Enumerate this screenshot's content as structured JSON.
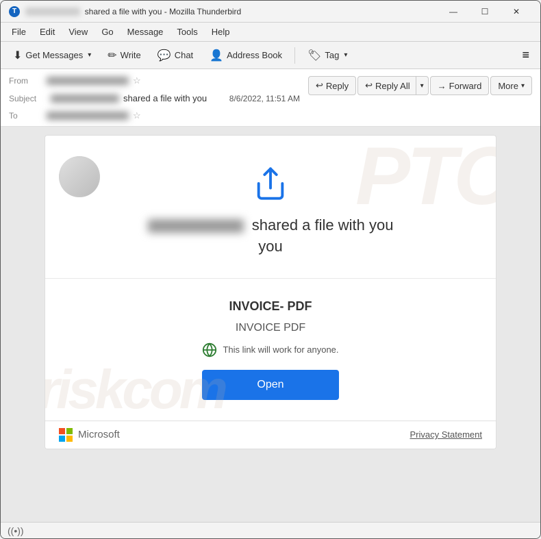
{
  "window": {
    "title_prefix": "shared a file with you - Mozilla Thunderbird",
    "icon": "T"
  },
  "titlebar": {
    "minimize": "—",
    "maximize": "☐",
    "close": "✕"
  },
  "menubar": {
    "items": [
      "File",
      "Edit",
      "View",
      "Go",
      "Message",
      "Tools",
      "Help"
    ]
  },
  "toolbar": {
    "get_messages": "Get Messages",
    "write": "Write",
    "chat": "Chat",
    "address_book": "Address Book",
    "tag": "Tag",
    "hamburger": "≡"
  },
  "email_header": {
    "from_label": "From",
    "subject_label": "Subject",
    "to_label": "To",
    "subject_suffix": "shared a file with you",
    "timestamp": "8/6/2022, 11:51 AM"
  },
  "actions": {
    "reply": "Reply",
    "reply_all": "Reply All",
    "forward": "Forward",
    "more": "More"
  },
  "email_body": {
    "share_heading_suffix": "shared a file with you",
    "you": "you",
    "file_name_large": "INVOICE- PDF",
    "file_name_sub": "INVOICE PDF",
    "link_notice": "This link will work for anyone.",
    "open_button": "Open"
  },
  "footer": {
    "brand": "Microsoft",
    "privacy": "Privacy Statement"
  },
  "status_bar": {
    "icon": "((•))"
  }
}
